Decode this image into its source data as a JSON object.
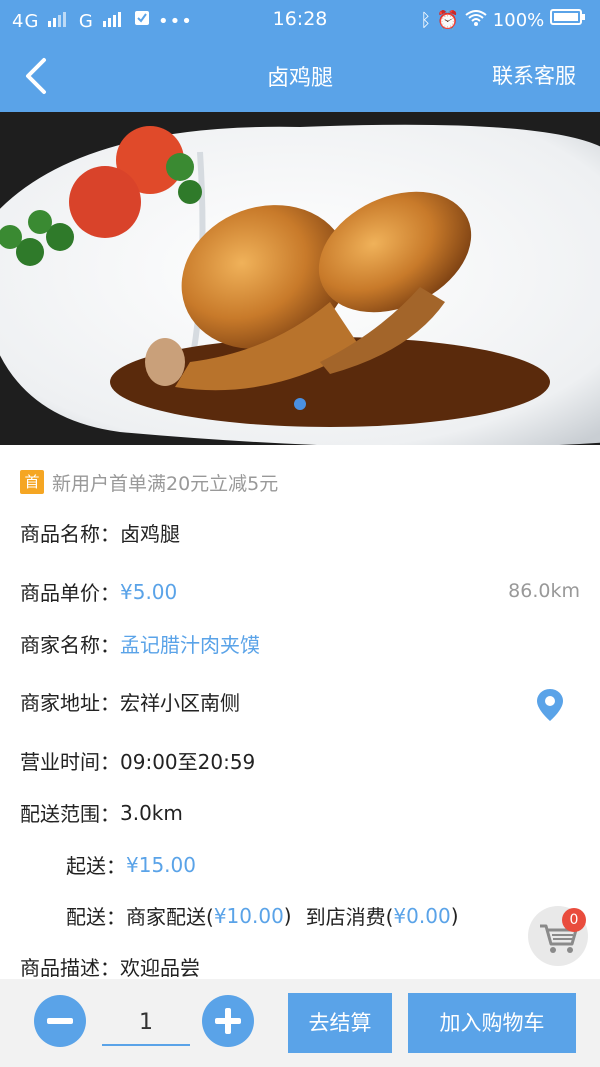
{
  "status_bar": {
    "network_left": "4G",
    "network_right": "G",
    "time": "16:28",
    "battery": "100%"
  },
  "navbar": {
    "title": "卤鸡腿",
    "service_label": "联系客服"
  },
  "hero": {
    "image_description": "product photo",
    "carousel_index": 1,
    "carousel_count": 1
  },
  "promo": {
    "badge": "首",
    "text": "新用户首单满20元立减5元"
  },
  "details": {
    "name_label": "商品名称：",
    "name_value": "卤鸡腿",
    "price_label": "商品单价：",
    "price_value": "¥5.00",
    "distance": "86.0km",
    "shop_label": "商家名称：",
    "shop_value": "孟记腊汁肉夹馍",
    "address_label": "商家地址：",
    "address_value": "宏祥小区南侧",
    "hours_label": "营业时间：",
    "hours_value": "09:00至20:59",
    "range_label": "配送范围：",
    "range_value": "3.0km",
    "min_label": "起送：",
    "min_value": "¥15.00",
    "delivery_label": "配送：",
    "delivery_type1": "商家配送(",
    "delivery_fee1": "¥10.00",
    "delivery_close1": ")",
    "delivery_type2": "到店消费(",
    "delivery_fee2": "¥0.00",
    "delivery_close2": ")",
    "desc_label": "商品描述：",
    "desc_value": "欢迎品尝"
  },
  "cart": {
    "count": "0"
  },
  "bottom": {
    "quantity": "1",
    "checkout_label": "去结算",
    "add_cart_label": "加入购物车"
  },
  "colors": {
    "primary": "#5aa3e8",
    "badge": "#f5a623",
    "cart_badge": "#e94c3d"
  }
}
